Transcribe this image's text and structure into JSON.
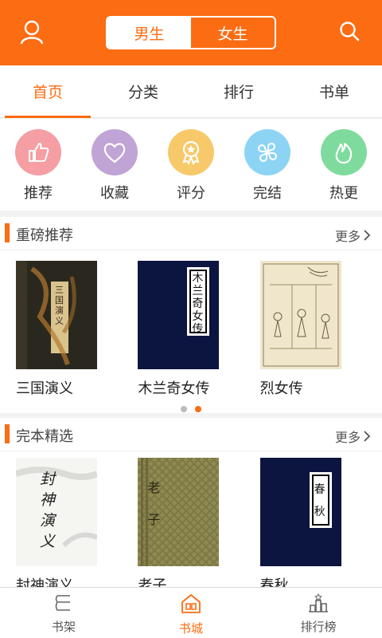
{
  "header": {
    "segments": [
      "男生",
      "女生"
    ],
    "active_segment": "男生"
  },
  "tabs": [
    {
      "label": "首页",
      "active": true
    },
    {
      "label": "分类",
      "active": false
    },
    {
      "label": "排行",
      "active": false
    },
    {
      "label": "书单",
      "active": false
    }
  ],
  "quick": [
    {
      "label": "推荐",
      "icon": "thumbs-up-icon",
      "color": "#f59ea3"
    },
    {
      "label": "收藏",
      "icon": "heart-icon",
      "color": "#c0a4d5"
    },
    {
      "label": "评分",
      "icon": "medal-icon",
      "color": "#f8c96a"
    },
    {
      "label": "完结",
      "icon": "clover-icon",
      "color": "#8dd4f4"
    },
    {
      "label": "热更",
      "icon": "flame-icon",
      "color": "#7fdb9d"
    }
  ],
  "sections": [
    {
      "title": "重磅推荐",
      "more": "更多",
      "books": [
        {
          "title": "三国演义",
          "cover_text": "三国演义"
        },
        {
          "title": "木兰奇女传",
          "cover_text": "木兰奇女传"
        },
        {
          "title": "烈女传",
          "cover_text": ""
        }
      ],
      "pager": {
        "pages": 2,
        "active": 2
      }
    },
    {
      "title": "完本精选",
      "more": "更多",
      "books": [
        {
          "title": "封神演义",
          "cover_text": "封神演义"
        },
        {
          "title": "老子",
          "cover_text": "老子"
        },
        {
          "title": "春秋",
          "cover_text": "春秋"
        }
      ]
    }
  ],
  "bottom_nav": [
    {
      "label": "书架",
      "icon": "bookshelf-icon",
      "active": false
    },
    {
      "label": "书城",
      "icon": "bookstore-icon",
      "active": true
    },
    {
      "label": "排行榜",
      "icon": "ranking-icon",
      "active": false
    }
  ],
  "colors": {
    "accent": "#fb6c13",
    "cover_navy": "#0c1440"
  }
}
